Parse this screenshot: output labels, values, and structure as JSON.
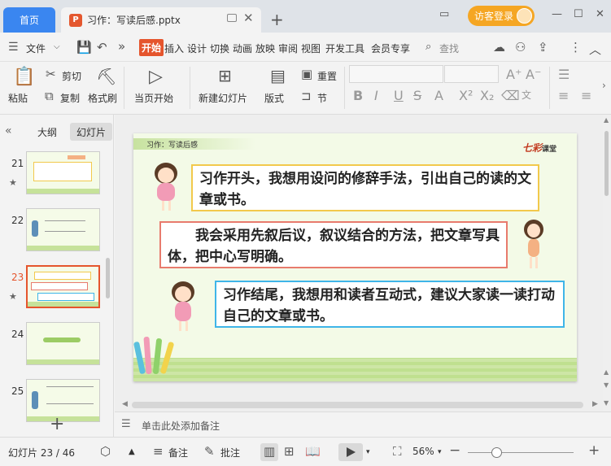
{
  "titlebar": {
    "home_tab": "首页",
    "doc_tab": "习作：写读后感.pptx",
    "login_label": "访客登录"
  },
  "menubar": {
    "file": "文件",
    "items": [
      "开始",
      "插入",
      "设计",
      "切换",
      "动画",
      "放映",
      "审阅",
      "视图",
      "开发工具",
      "会员专享"
    ],
    "search": "查找"
  },
  "ribbon": {
    "paste": "粘贴",
    "cut": "剪切",
    "copy": "复制",
    "format_painter": "格式刷",
    "play_from_current": "当页开始",
    "new_slide": "新建幻灯片",
    "layout": "版式",
    "reset": "重置",
    "section": "节"
  },
  "left_panel": {
    "outline_tab": "大纲",
    "slides_tab": "幻灯片",
    "slides": [
      {
        "num": "21",
        "has_star": true,
        "current": false
      },
      {
        "num": "22",
        "has_star": false,
        "current": false
      },
      {
        "num": "23",
        "has_star": true,
        "current": true
      },
      {
        "num": "24",
        "has_star": false,
        "current": false
      },
      {
        "num": "25",
        "has_star": false,
        "current": false
      }
    ]
  },
  "slide": {
    "header": "习作：写读后感",
    "brand": "七彩",
    "brand_suffix": "课堂",
    "box1": "习作开头，我想用设问的修辞手法，引出自己的读的文章或书。",
    "box2": "我会采用先叙后议，叙议结合的方法，把文章写具体，把中心写明确。",
    "box3": "习作结尾，我想用和读者互动式，建议大家读一读打动自己的文章或书。"
  },
  "notes": {
    "placeholder": "单击此处添加备注"
  },
  "statusbar": {
    "slide_counter": "幻灯片 23 / 46",
    "notes": "备注",
    "comment": "批注",
    "zoom": "56%"
  },
  "colors": {
    "accent": "#e5552d",
    "home_tab": "#3a86f0",
    "login": "#f5a623"
  }
}
